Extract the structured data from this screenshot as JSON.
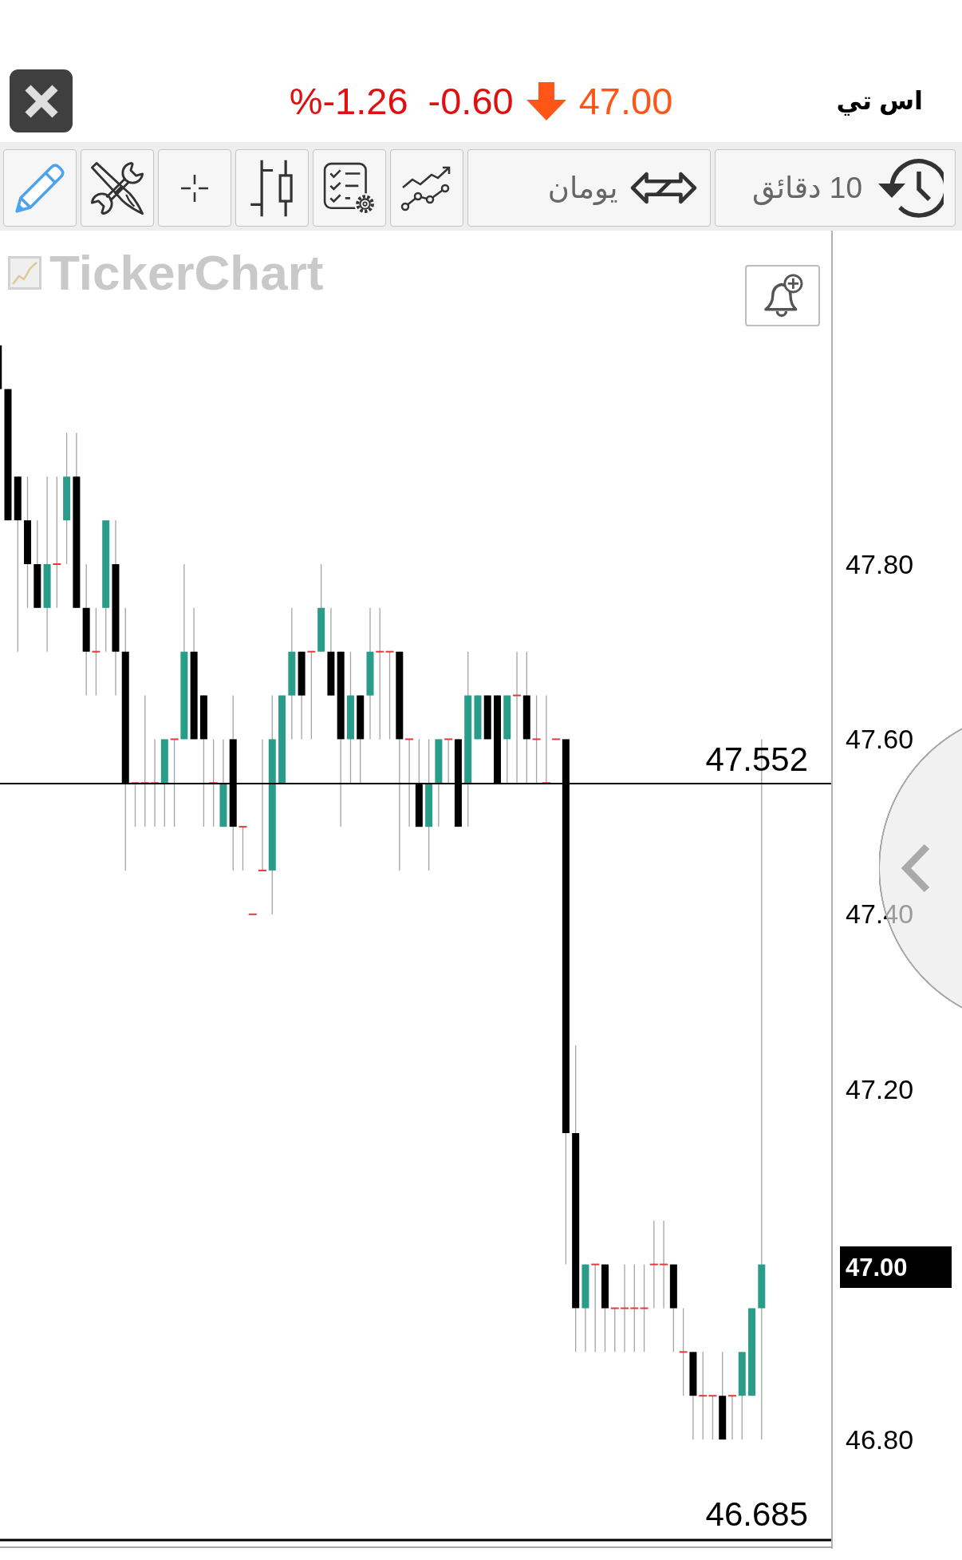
{
  "header": {
    "symbol": "اس تي",
    "last_price": "47.00",
    "falling": true,
    "change": "-0.60",
    "change_percent": "%-1.26"
  },
  "toolbar": {
    "range": "يومان",
    "interval": "10 دقائق"
  },
  "chart": {
    "logo": "TickerChart",
    "price_lines": [
      {
        "label": "47.552"
      },
      {
        "label": "46.685"
      }
    ],
    "price_axis": [
      "47.80",
      "47.60",
      "47.40",
      "47.20",
      "46.80"
    ],
    "last_price_tag": "47.00"
  }
}
